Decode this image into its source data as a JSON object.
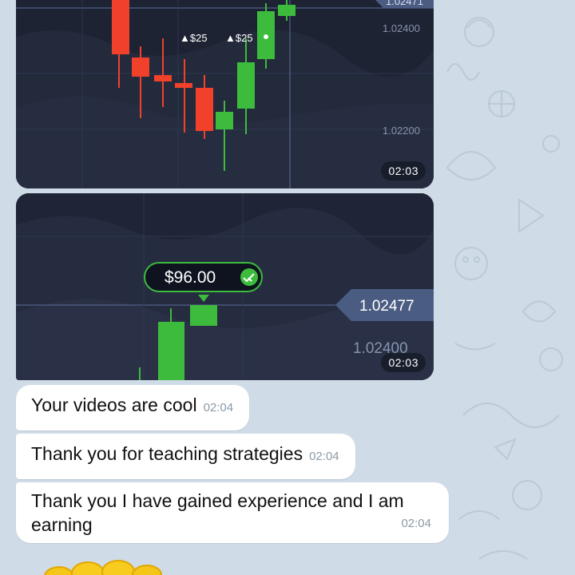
{
  "photos": [
    {
      "time": "02:03",
      "prices": {
        "current": "1.02471",
        "upper": "1.02400",
        "lower": "1.02200"
      },
      "trade_markers": [
        "▲$25",
        "▲$25"
      ]
    },
    {
      "time": "02:03",
      "profit_label": "$96.00",
      "prices": {
        "current": "1.02477",
        "level": "1.02400"
      }
    }
  ],
  "messages": [
    {
      "text": "Your videos are cool",
      "time": "02:04"
    },
    {
      "text": "Thank you for teaching strategies",
      "time": "02:04"
    },
    {
      "text": "Thank you I have gained experience and I am earning",
      "time": "02:04"
    }
  ],
  "colors": {
    "bullish": "#3dbb3d",
    "bearish": "#f2412b",
    "chart_bg": "#1d2333",
    "price_tag": "#4b5c83"
  }
}
